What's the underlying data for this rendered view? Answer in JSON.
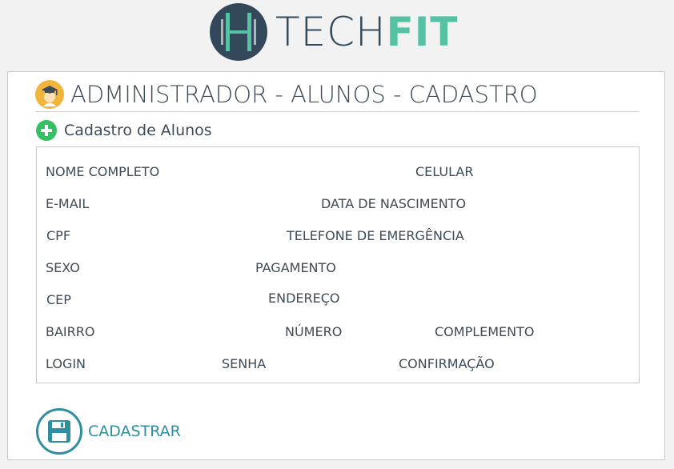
{
  "brand": {
    "logo_letter": "H",
    "name_part1": "TECH",
    "name_part2": "FIT",
    "color_dark": "#33485a",
    "color_accent": "#55c2a4"
  },
  "header": {
    "icon": "graduate-icon",
    "title": "ADMINISTRADOR - ALUNOS - CADASTRO"
  },
  "section": {
    "icon": "plus-circle-icon",
    "title": "Cadastro de Alunos"
  },
  "form": {
    "fields": {
      "nome_completo": "NOME COMPLETO",
      "celular": "CELULAR",
      "email": "E-MAIL",
      "data_nascimento": "DATA DE NASCIMENTO",
      "cpf": "CPF",
      "telefone_emergencia": "TELEFONE DE EMERGÊNCIA",
      "sexo": "SEXO",
      "pagamento": "PAGAMENTO",
      "cep": "CEP",
      "endereco": "ENDEREÇO",
      "bairro": "BAIRRO",
      "numero": "NÚMERO",
      "complemento": "COMPLEMENTO",
      "login": "LOGIN",
      "senha": "SENHA",
      "confirmacao": "CONFIRMAÇÃO"
    }
  },
  "actions": {
    "save_icon": "floppy-disk-icon",
    "save_label": "CADASTRAR",
    "save_color": "#2f8ea0"
  },
  "colors": {
    "add_green": "#34c063",
    "header_icon_bg": "#f0b53a"
  }
}
